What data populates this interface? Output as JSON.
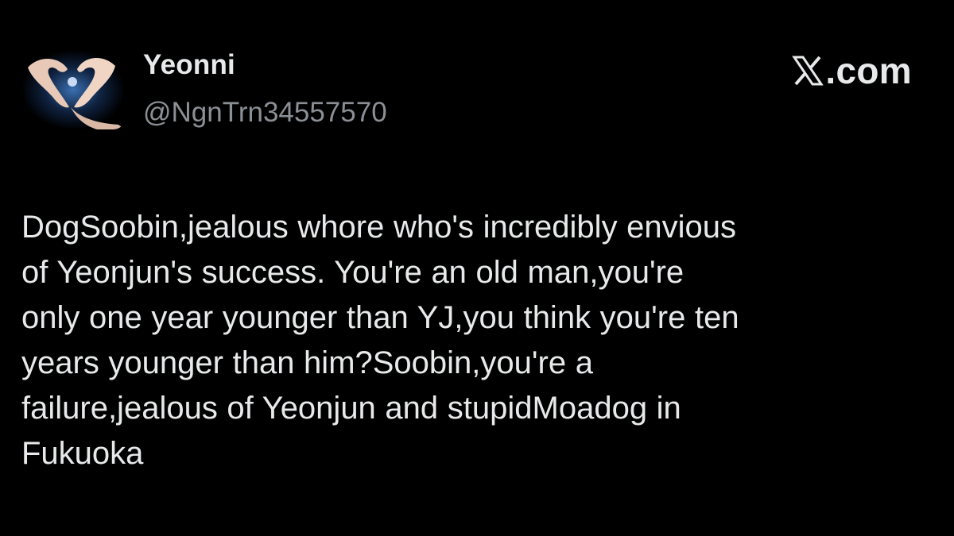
{
  "tweet": {
    "author": {
      "display_name": "Yeonni",
      "handle": "@NgnTrn34557570",
      "avatar_icon": "heart-hands-avatar"
    },
    "brand": {
      "icon": "x-logo-icon",
      "text": ".com"
    },
    "text": "DogSoobin,jealous whore who's incredibly envious\nof Yeonjun's success. You're an old man,you're\nonly one year younger than YJ,you think you're ten\nyears younger than him?Soobin,you're a\nfailure,jealous of Yeonjun and stupidMoadog in\nFukuoka"
  },
  "colors": {
    "background": "#000000",
    "text_primary": "#e7e9ea",
    "text_secondary": "#8b9096",
    "accent": "#1d9bf0"
  }
}
